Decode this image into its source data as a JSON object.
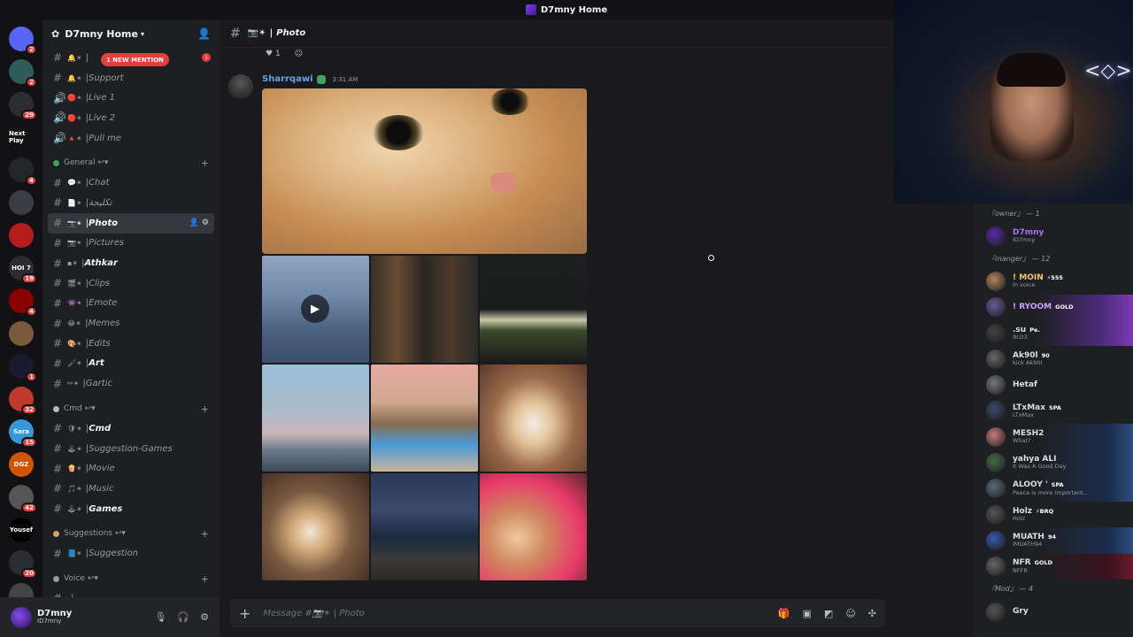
{
  "window": {
    "title": "D7mny Home"
  },
  "guilds": [
    {
      "name": "discord-home",
      "color": "#5865f2",
      "label": "",
      "badge": "2"
    },
    {
      "name": "server-1",
      "color": "#2f5c5a",
      "label": "",
      "badge": "2"
    },
    {
      "name": "server-2",
      "color": "#2b2d31",
      "label": "",
      "badge": "29"
    },
    {
      "name": "next-play",
      "color": "#121214",
      "label": "Next Play",
      "badge": ""
    },
    {
      "name": "server-4",
      "color": "#23272a",
      "label": "",
      "badge": "4"
    },
    {
      "name": "server-5",
      "color": "#3a3d42",
      "label": "",
      "badge": ""
    },
    {
      "name": "server-6",
      "color": "#b71c1c",
      "label": "",
      "badge": ""
    },
    {
      "name": "server-7",
      "color": "#2b2d31",
      "label": "HOI 7",
      "badge": "19"
    },
    {
      "name": "server-8",
      "color": "#8b0000",
      "label": "",
      "badge": "4"
    },
    {
      "name": "server-9",
      "color": "#7a5a3a",
      "label": "",
      "badge": ""
    },
    {
      "name": "server-10",
      "color": "#1a1a2e",
      "label": "",
      "badge": "1"
    },
    {
      "name": "server-11",
      "color": "#c0392b",
      "label": "",
      "badge": "32"
    },
    {
      "name": "server-12",
      "color": "#3498db",
      "label": "Sara",
      "badge": "15"
    },
    {
      "name": "server-13",
      "color": "#d35400",
      "label": "DGZ",
      "badge": ""
    },
    {
      "name": "server-14",
      "color": "#555",
      "label": "",
      "badge": "42"
    },
    {
      "name": "server-15",
      "color": "#000",
      "label": "Yousef",
      "badge": ""
    },
    {
      "name": "server-16",
      "color": "#2b2d31",
      "label": "",
      "badge": "20"
    },
    {
      "name": "server-17",
      "color": "#444",
      "label": "",
      "badge": "15"
    },
    {
      "name": "server-18",
      "color": "#121214",
      "label": "",
      "badge": ""
    }
  ],
  "guild_new_label": "NEW",
  "server": {
    "name": "D7mny Home",
    "mention_pill": "1 NEW MENTION",
    "mention_count": "1",
    "top_channels": [
      {
        "icon": "hash",
        "emoji": "🔔✴",
        "name": "",
        "bold": false,
        "type": "text"
      },
      {
        "icon": "hash",
        "emoji": "🔔✴",
        "name": "Support",
        "bold": false,
        "type": "text"
      },
      {
        "icon": "speaker",
        "emoji": "🔴✴",
        "name": "Live 1",
        "bold": false,
        "type": "voice"
      },
      {
        "icon": "speaker",
        "emoji": "🔴✴",
        "name": "Live 2",
        "bold": false,
        "type": "voice"
      },
      {
        "icon": "speaker",
        "emoji": "🔺✴",
        "name": "Pull me",
        "bold": false,
        "type": "voice"
      }
    ],
    "categories": [
      {
        "name": "General ↩",
        "dot": "#3ba55d",
        "channels": [
          {
            "emoji": "💬✴",
            "name": "Chat",
            "bold": false,
            "active": false
          },
          {
            "emoji": "📄✴",
            "name": "تكليجة",
            "bold": false,
            "active": false
          },
          {
            "emoji": "📷✴",
            "name": "Photo",
            "bold": false,
            "active": true
          },
          {
            "emoji": "📷✴",
            "name": "Pictures",
            "bold": false,
            "active": false
          },
          {
            "emoji": "▪✴",
            "name": "Athkar",
            "bold": true,
            "active": false
          },
          {
            "emoji": "🎬✴",
            "name": "Clips",
            "bold": false,
            "active": false
          },
          {
            "emoji": "👾✴",
            "name": "Emote",
            "bold": false,
            "active": false
          },
          {
            "emoji": "😂✴",
            "name": "Memes",
            "bold": false,
            "active": false
          },
          {
            "emoji": "🎨✴",
            "name": "Edits",
            "bold": false,
            "active": false
          },
          {
            "emoji": "🖌✴",
            "name": "Art",
            "bold": true,
            "active": false
          },
          {
            "emoji": "✏✴",
            "name": "Gartic",
            "bold": false,
            "active": false
          }
        ]
      },
      {
        "name": "Cmd ↩",
        "dot": "#b5bac1",
        "channels": [
          {
            "emoji": "🛡✴",
            "name": "Cmd",
            "bold": true,
            "active": false
          },
          {
            "emoji": "🕹✴",
            "name": "Suggestion-Games",
            "bold": false,
            "active": false
          },
          {
            "emoji": "🍿✴",
            "name": "Movie",
            "bold": false,
            "active": false
          },
          {
            "emoji": "🎵✴",
            "name": "Music",
            "bold": false,
            "active": false
          },
          {
            "emoji": "🕹✴",
            "name": "Games",
            "bold": true,
            "active": false
          }
        ]
      },
      {
        "name": "Suggestions ↩",
        "dot": "#d9a066",
        "channels": [
          {
            "emoji": "📘✴",
            "name": "Suggestion",
            "bold": false,
            "active": false
          }
        ]
      },
      {
        "name": "Voice ↩",
        "dot": "#949ba4",
        "channels": [
          {
            "emoji": "",
            "name": "",
            "bold": false,
            "active": false
          }
        ]
      }
    ]
  },
  "user": {
    "name": "D7mny",
    "tag": "ID7mny"
  },
  "channel_header": {
    "emoji": "📷✴",
    "title": "Photo"
  },
  "reactions": {
    "count": "1"
  },
  "message": {
    "author": "Sharrqawi",
    "timestamp": "3:31 AM"
  },
  "composer": {
    "placeholder": "Message #📷✴ | Photo"
  },
  "members": {
    "groups": [
      {
        "title": "『owner』 — 1",
        "list": [
          {
            "name": "D7mny",
            "status": "ID7mny",
            "color": "#a970ff",
            "av": "#5a2aa8",
            "tag": "",
            "banner": ""
          }
        ]
      },
      {
        "title": "『manger』 — 12",
        "list": [
          {
            "name": "! MOIN",
            "status": "In voice",
            "color": "#f0c96b",
            "av": "#b08560",
            "tag": "⚡555",
            "banner": ""
          },
          {
            "name": "! RYOOM",
            "status": "",
            "color": "#c8a2ff",
            "av": "#6a5a9a",
            "tag": "GOLD",
            "banner": "banner"
          },
          {
            "name": ".su",
            "status": "9LO3",
            "color": "#dbdee1",
            "av": "#444",
            "tag": "Pe.",
            "banner": "banner"
          },
          {
            "name": "Ak90l",
            "status": "kick Ak90l",
            "color": "#dbdee1",
            "av": "#666",
            "tag": "90",
            "banner": ""
          },
          {
            "name": "Hetaf",
            "status": "",
            "color": "#dbdee1",
            "av": "#777",
            "tag": "",
            "banner": ""
          },
          {
            "name": "LTxMax",
            "status": "LTxMax",
            "color": "#dbdee1",
            "av": "#3a4a6a",
            "tag": "SPA",
            "banner": ""
          },
          {
            "name": "MESH2",
            "status": "What?",
            "color": "#dbdee1",
            "av": "#c87a7a",
            "tag": "",
            "banner": "banner2"
          },
          {
            "name": "yahya ALI",
            "status": "It Was A Good Day",
            "color": "#dbdee1",
            "av": "#4a6a4a",
            "tag": "",
            "banner": "banner2"
          },
          {
            "name": "ALOOY '",
            "status": "Peace is more important...",
            "color": "#dbdee1",
            "av": "#5a6a7a",
            "tag": "SPA",
            "banner": "banner2"
          },
          {
            "name": "Holz",
            "status": "Holz",
            "color": "#dbdee1",
            "av": "#555",
            "tag": "⚡BRQ",
            "banner": ""
          },
          {
            "name": "MUATH",
            "status": "iMUATH94",
            "color": "#dbdee1",
            "av": "#3a5aaa",
            "tag": "94",
            "banner": "banner2"
          },
          {
            "name": "NFR",
            "status": "NFFR",
            "color": "#dbdee1",
            "av": "#666",
            "tag": "GOLD",
            "banner": "banner3"
          }
        ]
      },
      {
        "title": "『Mod』 — 4",
        "list": [
          {
            "name": "Gry",
            "status": "",
            "color": "#dbdee1",
            "av": "#555",
            "tag": "",
            "banner": ""
          }
        ]
      }
    ]
  },
  "colors": {
    "accent": "#5865f2",
    "mention": "#e53c3c",
    "author": "#5ea3ec"
  }
}
